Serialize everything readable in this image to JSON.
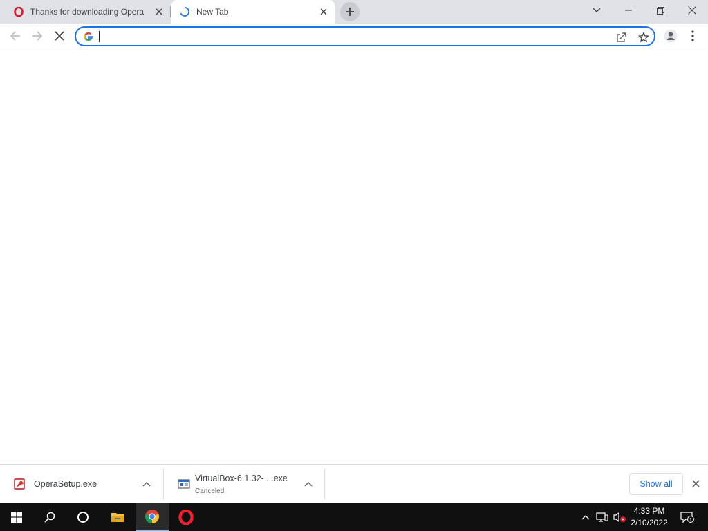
{
  "tabs": [
    {
      "title": "Thanks for downloading Opera",
      "icon": "opera-icon",
      "active": false
    },
    {
      "title": "New Tab",
      "icon": "loading-spinner-icon",
      "active": true
    }
  ],
  "omnibox": {
    "value": "",
    "placeholder": ""
  },
  "downloads": [
    {
      "filename": "OperaSetup.exe",
      "status": "",
      "icon": "opera-installer-icon"
    },
    {
      "filename": "VirtualBox-6.1.32-....exe",
      "status": "Canceled",
      "icon": "exe-file-icon"
    }
  ],
  "shelf": {
    "show_all_label": "Show all"
  },
  "taskbar": {
    "items": [
      "start-icon",
      "search-icon",
      "cortana-icon",
      "file-explorer-icon",
      "chrome-icon",
      "opera-icon"
    ],
    "active": "chrome-icon"
  },
  "clock": {
    "time": "4:33 PM",
    "date": "2/10/2022"
  },
  "colors": {
    "accent": "#1a73e8",
    "tabstrip": "#dee1e6",
    "taskbar": "#101010"
  }
}
